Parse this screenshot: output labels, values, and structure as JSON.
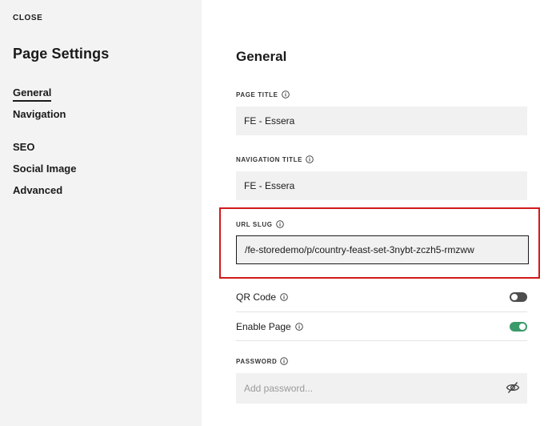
{
  "sidebar": {
    "close_label": "CLOSE",
    "title": "Page Settings",
    "items": [
      {
        "label": "General"
      },
      {
        "label": "Navigation"
      },
      {
        "label": "SEO"
      },
      {
        "label": "Social Image"
      },
      {
        "label": "Advanced"
      }
    ]
  },
  "main": {
    "section_title": "General",
    "page_title": {
      "label": "PAGE TITLE",
      "value": "FE - Essera"
    },
    "navigation_title": {
      "label": "NAVIGATION TITLE",
      "value": "FE - Essera"
    },
    "url_slug": {
      "label": "URL SLUG",
      "value": "/fe-storedemo/p/country-feast-set-3nybt-zczh5-rmzww"
    },
    "qr_code": {
      "label": "QR Code",
      "enabled": false
    },
    "enable_page": {
      "label": "Enable Page",
      "enabled": true
    },
    "password": {
      "label": "PASSWORD",
      "placeholder": "Add password..."
    }
  },
  "colors": {
    "highlight": "#d11a1a",
    "toggle_on": "#3a9a6a",
    "toggle_off": "#4d4d4d"
  },
  "icons": {
    "info": "info-icon",
    "password_visibility": "eye-off-icon"
  }
}
